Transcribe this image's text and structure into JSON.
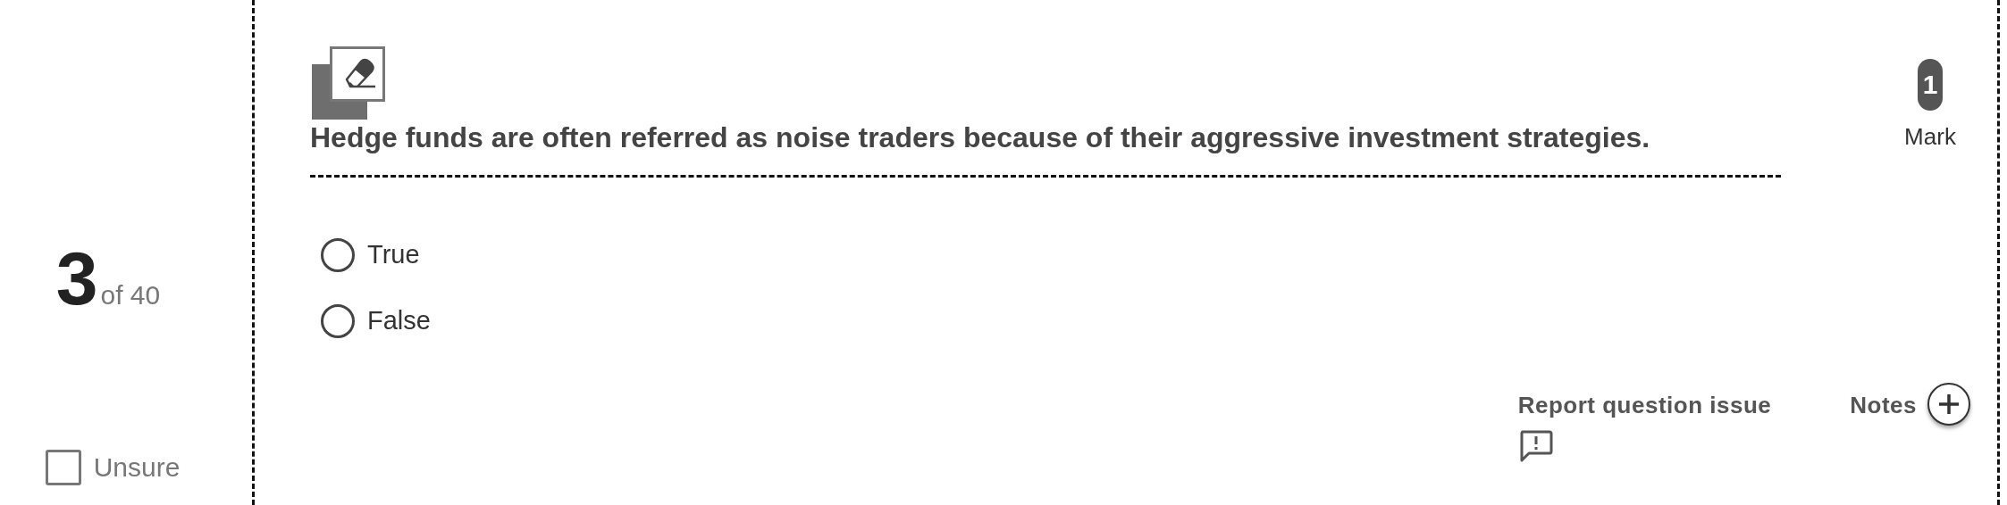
{
  "question_number": {
    "current": "3",
    "total": "of 40"
  },
  "unsure": {
    "label": "Unsure",
    "checked": false
  },
  "question": {
    "text": "Hedge funds are often referred as noise traders because of their aggressive investment strategies.",
    "marks": "1",
    "marks_label": "Mark"
  },
  "options": [
    {
      "label": "True",
      "selected": false
    },
    {
      "label": "False",
      "selected": false
    }
  ],
  "actions": {
    "report": "Report question issue",
    "notes": "Notes"
  }
}
